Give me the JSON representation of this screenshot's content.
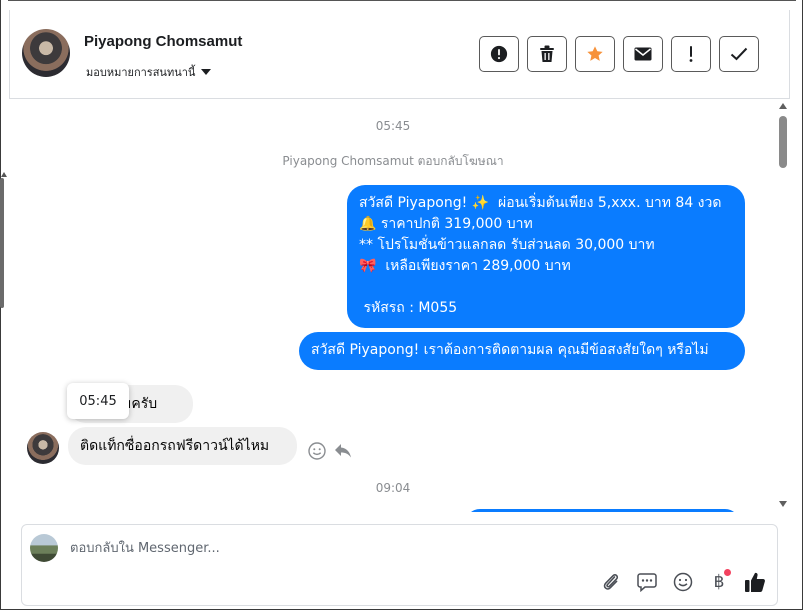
{
  "header": {
    "contact_name": "Piyapong Chomsamut",
    "assign_label": "มอบหมายการสนทนานี้",
    "actions": [
      {
        "name": "spam-button",
        "icon": "alert-circle-icon"
      },
      {
        "name": "delete-button",
        "icon": "trash-icon"
      },
      {
        "name": "star-button",
        "icon": "star-icon"
      },
      {
        "name": "mark-unread-button",
        "icon": "envelope-icon"
      },
      {
        "name": "follow-up-button",
        "icon": "exclamation-icon"
      },
      {
        "name": "done-button",
        "icon": "check-icon"
      }
    ]
  },
  "colors": {
    "outgoing_bubble": "#0a7cff",
    "incoming_bubble": "#f0f0f0",
    "star": "#f7923a",
    "notification_dot": "#f3425f"
  },
  "chat": {
    "timestamp_1": "05:45",
    "system_message": "Piyapong Chomsamut ตอบกลับโฆษณา",
    "outgoing_1": {
      "line_1": "สวัสดี Piyapong! ✨  ผ่อนเริ่มต้นเพียง 5,xxx. บาท 84 งวด",
      "line_2": "🔔 ราคาปกติ 319,000 บาท",
      "line_3": "** โปรโมชั่นข้าวแลกลด รับส่วนลด 30,000 บาท",
      "line_4": "🎀  เหลือเพียงราคา 289,000 บาท",
      "line_5": "",
      "line_6": " รหัสรถ : M055"
    },
    "outgoing_2": "สวัสดี Piyapong! เราต้องการติดตามผล คุณมีข้อสงสัยใดๆ หรือไม่",
    "incoming_1": "สอบถามครับ",
    "incoming_2": "ติดแท็กซื่ออกรถฟรีดาวน์ได้ไหม",
    "tooltip_time": "05:45",
    "timestamp_2": "09:04"
  },
  "composer": {
    "placeholder": "ตอบกลับใน Messenger...",
    "currency_symbol": "฿"
  }
}
